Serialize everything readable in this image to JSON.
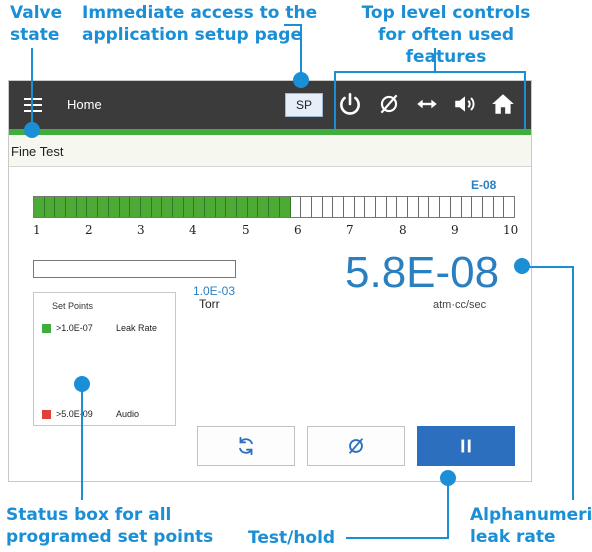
{
  "callouts": {
    "valve_state": [
      "Valve",
      "state"
    ],
    "setup_access": [
      "Immediate access to the",
      "application setup page"
    ],
    "top_controls": [
      "Top level controls",
      "for often used features"
    ],
    "status_box": [
      "Status box for all",
      "programed set points"
    ],
    "test_hold": "Test/hold",
    "alphanumeric": [
      "Alphanumeric",
      "leak rate"
    ]
  },
  "topbar": {
    "menu_icon": "hamburger-icon",
    "home_label": "Home",
    "sp_label": "SP",
    "controls": [
      "power-icon",
      "zero-icon",
      "vent-arrows-icon",
      "speaker-icon",
      "home-icon"
    ]
  },
  "status": {
    "text": "Fine Test"
  },
  "bargraph": {
    "exponent_label": "E-08",
    "scale": [
      "1",
      "2",
      "3",
      "4",
      "5",
      "6",
      "7",
      "8",
      "9",
      "10"
    ],
    "total_cells": 45,
    "lit_cells": 24,
    "lit_color": "#4caa35"
  },
  "threshold": {
    "value": "1.0E-03",
    "unit": "Torr"
  },
  "leak_rate": {
    "value": "5.8E-08",
    "unit": "atm·cc/sec",
    "color": "#2a7fc1"
  },
  "setpoints": {
    "title": "Set Points",
    "items": [
      {
        "value": ">1.0E-07",
        "label": "Leak Rate",
        "color": "#3fae3f"
      },
      {
        "value": ">5.0E-09",
        "label": "Audio",
        "color": "#e0403a"
      }
    ]
  },
  "bottom_buttons": [
    "refresh-icon",
    "zero-icon",
    "pause-icon"
  ],
  "accent_color": "#1a8fd6"
}
